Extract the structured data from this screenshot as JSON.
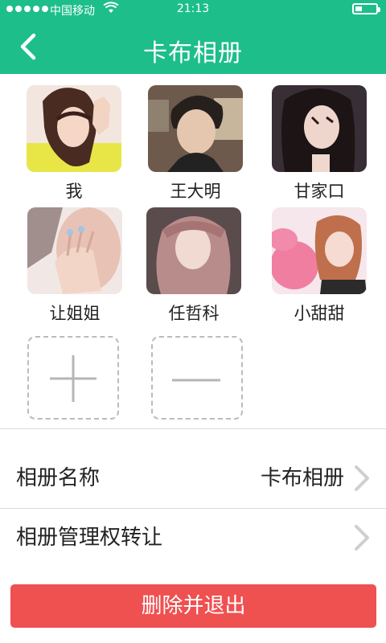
{
  "status_bar": {
    "carrier": "中国移动",
    "time": "21:13",
    "wifi_icon": "wifi-icon",
    "battery_icon": "battery-icon"
  },
  "header": {
    "title": "卡布相册",
    "back_icon": "back-chevron-icon",
    "background_color": "#1dbe8a"
  },
  "members": [
    {
      "name": "我",
      "avatar": "avatar-photo-1"
    },
    {
      "name": "王大明",
      "avatar": "avatar-photo-2"
    },
    {
      "name": "甘家口",
      "avatar": "avatar-photo-3"
    },
    {
      "name": "让姐姐",
      "avatar": "avatar-photo-4"
    },
    {
      "name": "任哲科",
      "avatar": "avatar-photo-5"
    },
    {
      "name": "小甜甜",
      "avatar": "avatar-photo-6"
    }
  ],
  "member_actions": {
    "add_icon": "plus-icon",
    "remove_icon": "minus-icon"
  },
  "settings": [
    {
      "label": "相册名称",
      "value": "卡布相册",
      "icon": "chevron-right-icon"
    },
    {
      "label": "相册管理权转让",
      "value": "",
      "icon": "chevron-right-icon"
    }
  ],
  "delete_button": {
    "label": "删除并退出",
    "color": "#ef5050"
  }
}
